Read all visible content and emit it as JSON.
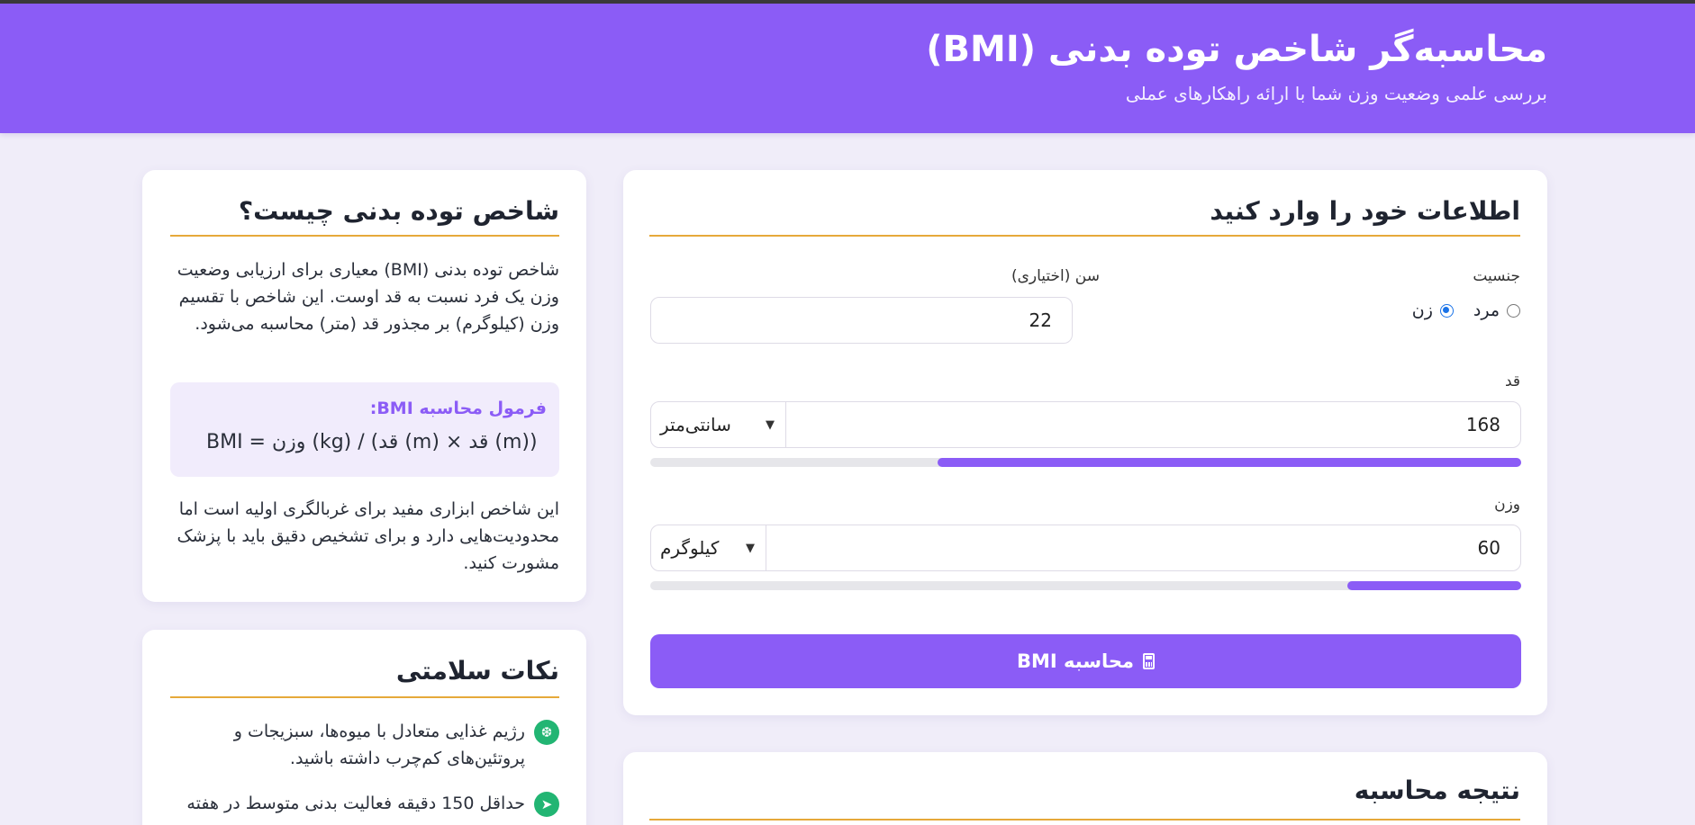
{
  "header": {
    "title": "محاسبه‌گر شاخص توده بدنی (BMI)",
    "subtitle": "بررسی علمی وضعیت وزن شما با ارائه راهکارهای عملی"
  },
  "form": {
    "title": "اطلاعات خود را وارد کنید",
    "gender": {
      "label": "جنسیت",
      "options": [
        "مرد",
        "زن"
      ],
      "selected": "زن"
    },
    "age": {
      "label": "سن (اختیاری)",
      "value": "22"
    },
    "height": {
      "label": "قد",
      "value": "168",
      "unit": "سانتی‌متر",
      "slider_fraction": 0.67
    },
    "weight": {
      "label": "وزن",
      "value": "60",
      "unit": "کیلوگرم",
      "slider_fraction": 0.2
    },
    "submit_label": "محاسبه BMI"
  },
  "result": {
    "title": "نتیجه محاسبه"
  },
  "info": {
    "title": "شاخص توده بدنی چیست؟",
    "intro": "شاخص توده بدنی (BMI) معیاری برای ارزیابی وضعیت وزن یک فرد نسبت به قد اوست. این شاخص با تقسیم وزن (کیلوگرم) بر مجذور قد (متر) محاسبه می‌شود.",
    "formula_title": "فرمول محاسبه BMI:",
    "formula": "BMI = وزن (kg) / (قد (m) × قد (m))",
    "note": "این شاخص ابزاری مفید برای غربالگری اولیه است اما محدودیت‌هایی دارد و برای تشخیص دقیق باید با پزشک مشورت کنید."
  },
  "tips": {
    "title": "نکات سلامتی",
    "items": [
      {
        "icon": "utensils-icon",
        "text": "رژیم غذایی متعادل با میوه‌ها، سبزیجات و پروتئین‌های کم‌چرب داشته باشید."
      },
      {
        "icon": "running-icon",
        "text": "حداقل 150 دقیقه فعالیت بدنی متوسط در هفته"
      }
    ]
  },
  "colors": {
    "accent": "#8b5cf6",
    "rule": "#e6a93a",
    "tip_icon": "#22b573",
    "background": "#f0edf9"
  }
}
